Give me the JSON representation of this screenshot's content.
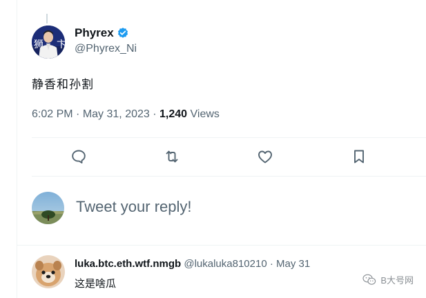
{
  "tweet": {
    "author_name": "Phyrex",
    "author_handle": "@Phyrex_Ni",
    "text": "静香和孙割",
    "time": "6:02 PM",
    "date": "May 31, 2023",
    "views_count": "1,240",
    "views_label": "Views"
  },
  "actions": [
    "reply-icon",
    "retweet-icon",
    "like-icon",
    "bookmark-icon"
  ],
  "composer": {
    "placeholder": "Tweet your reply!"
  },
  "reply": {
    "name": "luka.btc.eth.wtf.nmgb",
    "handle": "@lukaluka810210",
    "date": "May 31",
    "text": "这是啥瓜"
  },
  "watermark": {
    "text": "B大号网"
  },
  "colors": {
    "text": "#0f1419",
    "secondary": "#536471",
    "verified": "#1d9bf0",
    "divider": "#eff3f4"
  }
}
